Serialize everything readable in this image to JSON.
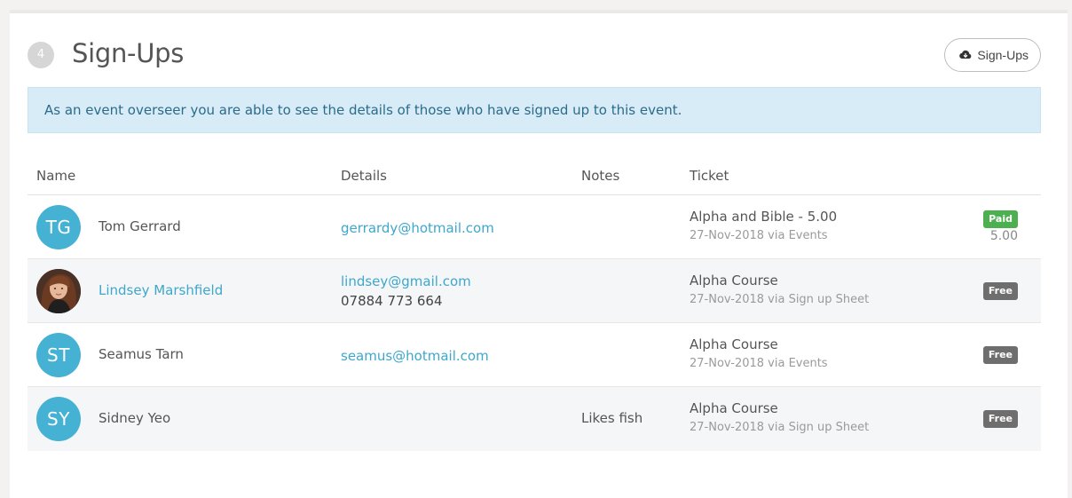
{
  "section": {
    "step": "4",
    "title": "Sign-Ups",
    "export_label": "Sign-Ups",
    "export_icon": "cloud-download-icon"
  },
  "alert": {
    "text": "As an event overseer you are able to see the details of those who have signed up to this event."
  },
  "table": {
    "headers": {
      "name": "Name",
      "details": "Details",
      "notes": "Notes",
      "ticket": "Ticket"
    },
    "rows": [
      {
        "initials": "TG",
        "name": "Tom Gerrard",
        "email": "gerrardy@hotmail.com",
        "phone": "",
        "notes": "",
        "ticket_name": "Alpha and Bible - 5.00",
        "ticket_meta": "27-Nov-2018 via Events",
        "status": "Paid",
        "amount": "5.00"
      },
      {
        "initials": "",
        "name": "Lindsey Marshfield",
        "email": "lindsey@gmail.com",
        "phone": "07884 773 664",
        "notes": "",
        "ticket_name": "Alpha Course",
        "ticket_meta": "27-Nov-2018 via Sign up Sheet",
        "status": "Free",
        "amount": ""
      },
      {
        "initials": "ST",
        "name": "Seamus Tarn",
        "email": "seamus@hotmail.com",
        "phone": "",
        "notes": "",
        "ticket_name": "Alpha Course",
        "ticket_meta": "27-Nov-2018 via Events",
        "status": "Free",
        "amount": ""
      },
      {
        "initials": "SY",
        "name": "Sidney Yeo",
        "email": "",
        "phone": "",
        "notes": "Likes fish",
        "ticket_name": "Alpha Course",
        "ticket_meta": "27-Nov-2018 via Sign up Sheet",
        "status": "Free",
        "amount": ""
      }
    ]
  },
  "colors": {
    "avatar": "#45b1d3",
    "link": "#3ea7cc",
    "paid": "#4caf50",
    "free": "#6e6e6e",
    "alert_bg": "#d7ecf6"
  }
}
